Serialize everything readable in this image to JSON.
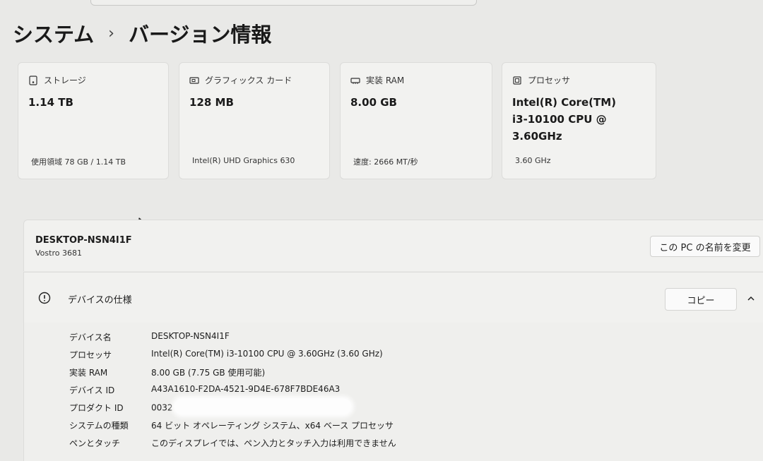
{
  "breadcrumb": {
    "parent": "システム",
    "separator": "›",
    "current": "バージョン情報"
  },
  "cards": [
    {
      "icon": "storage-icon",
      "title": "ストレージ",
      "value": "1.14 TB",
      "sub": "使用領域 78 GB / 1.14 TB"
    },
    {
      "icon": "graphics-card-icon",
      "title": "グラフィックス カード",
      "value": "128 MB",
      "sub": "Intel(R) UHD Graphics 630"
    },
    {
      "icon": "ram-icon",
      "title": "実装 RAM",
      "value": "8.00 GB",
      "sub": "速度: 2666 MT/秒"
    },
    {
      "icon": "processor-icon",
      "title": "プロセッサ",
      "value_lines": [
        "Intel(R) Core(TM)",
        "i3-10100 CPU @",
        "3.60GHz"
      ],
      "sub": "3.60 GHz"
    }
  ],
  "device": {
    "name": "DESKTOP-NSN4I1F",
    "model": "Vostro 3681",
    "rename_label": "この PC の名前を変更"
  },
  "specs": {
    "title": "デバイスの仕様",
    "copy_label": "コピー",
    "rows": [
      {
        "label": "デバイス名",
        "value": "DESKTOP-NSN4I1F"
      },
      {
        "label": "プロセッサ",
        "value": "Intel(R) Core(TM) i3-10100 CPU @ 3.60GHz (3.60 GHz)"
      },
      {
        "label": "実装 RAM",
        "value": "8.00 GB (7.75 GB 使用可能)"
      },
      {
        "label": "デバイス ID",
        "value": "A43A1610-F2DA-4521-9D4E-678F7BDE46A3"
      },
      {
        "label": "プロダクト ID",
        "value": "0032"
      },
      {
        "label": "システムの種類",
        "value": "64 ビット オペレーティング システム、x64 ベース プロセッサ"
      },
      {
        "label": "ペンとタッチ",
        "value": "このディスプレイでは、ペン入力とタッチ入力は利用できません"
      }
    ]
  }
}
